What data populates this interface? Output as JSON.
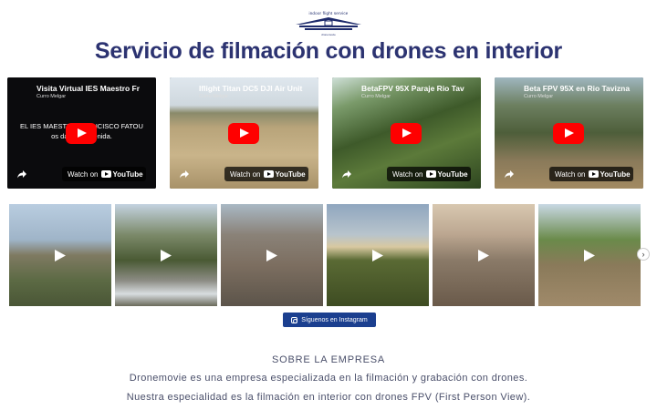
{
  "header": {
    "logo_text": "indoor flight service",
    "logo_tag": "dronemovie"
  },
  "page_title": "Servicio de filmación con drones en interior",
  "videos": [
    {
      "title": "Visita Virtual IES Maestro Fr",
      "channel": "Curro Melgar",
      "overlay": "EL IES MAESTRO FRANCISCO FATOU\nos da la bienvenida.",
      "watch_label": "Watch on",
      "youtube_label": "YouTube"
    },
    {
      "title": "Iflight Titan DC5 DJI Air Unit",
      "channel": "Curro Melgar",
      "overlay": "",
      "watch_label": "Watch on",
      "youtube_label": "YouTube"
    },
    {
      "title": "BetaFPV 95X Paraje Rio Tav",
      "channel": "Curro Melgar",
      "overlay": "",
      "watch_label": "Watch on",
      "youtube_label": "YouTube"
    },
    {
      "title": "Beta FPV 95X en Rio Tavizna",
      "channel": "Curro Melgar",
      "overlay": "",
      "watch_label": "Watch on",
      "youtube_label": "YouTube"
    }
  ],
  "instagram": {
    "tile_count": 6,
    "button_label": "Síguenos en Instagram",
    "next_icon": "chevron-right-icon"
  },
  "about": {
    "title": "SOBRE LA EMPRESA",
    "line1": "Dronemovie es una empresa especializada en la filmación y grabación con drones.",
    "line2": "Nuestra especialidad es la filmación en interior con drones FPV (First Person View)."
  },
  "colors": {
    "title": "#2c3371",
    "button": "#1b3f8f",
    "youtube_red": "#ff0000",
    "body_text": "#4a4f6a"
  }
}
